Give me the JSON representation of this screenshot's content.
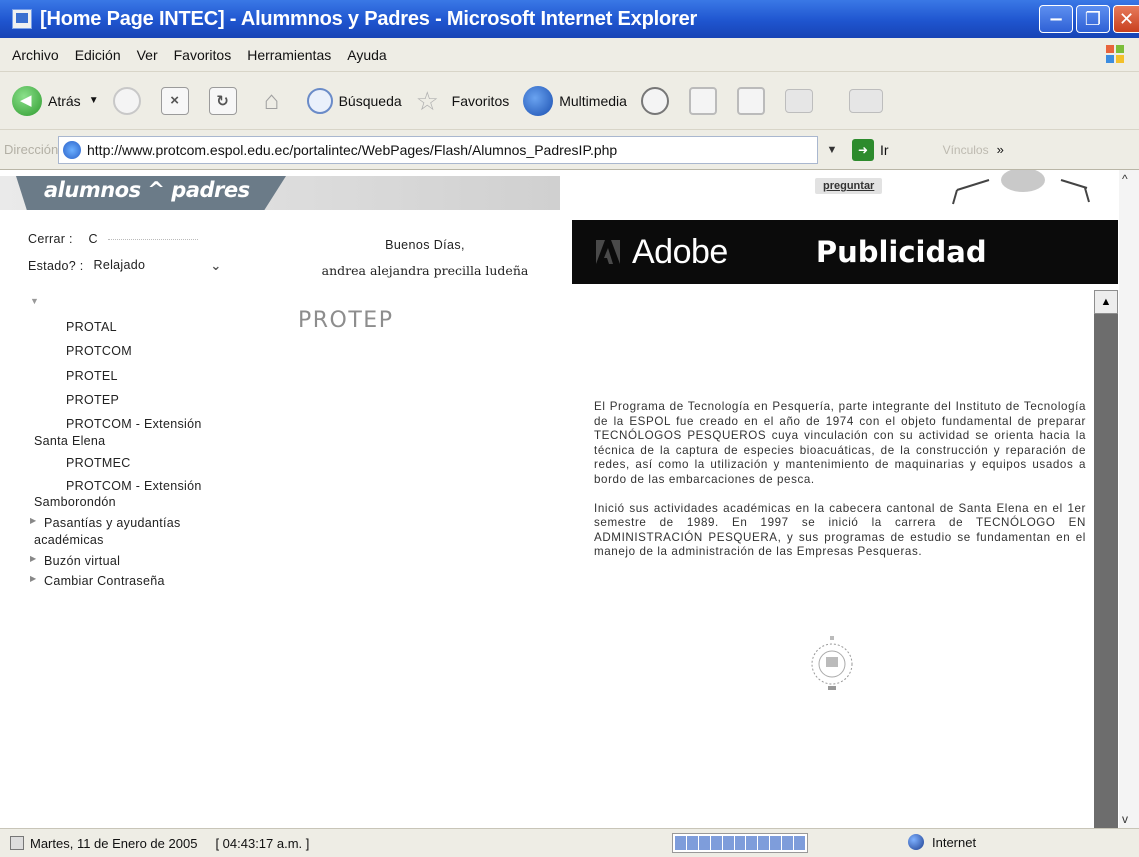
{
  "window": {
    "title": "[Home Page INTEC] - Alummnos y Padres - Microsoft Internet Explorer",
    "buttons": [
      "minimize",
      "maximize",
      "close"
    ]
  },
  "menubar": {
    "items": [
      "Archivo",
      "Edición",
      "Ver",
      "Favoritos",
      "Herramientas",
      "Ayuda"
    ]
  },
  "toolbar": {
    "back_label": "Atrás",
    "search_label": "Búsqueda",
    "favorites_label": "Favoritos",
    "media_label": "Multimedia"
  },
  "address": {
    "label": "Dirección",
    "url": "http://www.protcom.espol.edu.ec/portalintec/WebPages/Flash/Alumnos_PadresIP.php",
    "go_label": "Ir",
    "links_label": "Vínculos"
  },
  "page": {
    "brand": "alumnos ^ padres",
    "ask_label": "preguntar",
    "close_label": "Cerrar :",
    "close_value": "C",
    "state_label": "Estado? :",
    "state_value": "Relajado",
    "greeting": "Buenos Días,",
    "user_name": "andrea alejandra precilla ludeña",
    "nav": {
      "programs": [
        "PROTAL",
        "PROTCOM",
        "PROTEL",
        "PROTEP"
      ],
      "ext1_line1": "PROTCOM - Extensión",
      "ext1_line2": "Santa Elena",
      "protmec": "PROTMEC",
      "ext2_line1": "PROTCOM - Extensión",
      "ext2_line2": "Samborondón",
      "pasantias_line1": "Pasantías y ayudantías",
      "pasantias_line2": "académicas",
      "buzon": "Buzón virtual",
      "cambiar": "Cambiar Contraseña"
    },
    "section_title": "PROTEP",
    "ad": {
      "brand": "Adobe",
      "title": "Publicidad"
    },
    "description": [
      "El Programa de Tecnología en Pesquería, parte integrante del Instituto de Tecnología de la ESPOL fue creado en el año de 1974 con el objeto fundamental de preparar TECNÓLOGOS PESQUEROS cuya vinculación con su actividad se orienta hacia la técnica de la captura de especies bioacuáticas, de la construcción y reparación de redes, así como la utilización y mantenimiento de maquinarias y equipos usados a bordo de las embarcaciones de pesca.",
      "Inició sus actividades académicas en la cabecera cantonal de Santa Elena en el 1er semestre de 1989. En 1997 se inició la carrera de TECNÓLOGO EN ADMINISTRACIÓN PESQUERA, y sus programas de estudio se fundamentan en el manejo de la administración de las Empresas Pesqueras."
    ]
  },
  "statusbar": {
    "date": "Martes, 11 de Enero de 2005",
    "time": "[ 04:43:17 a.m. ]",
    "zone": "Internet"
  },
  "colors": {
    "titlebar": "#1f55cf",
    "chrome": "#eeede5",
    "brand_tab": "#6b7b88",
    "ad_bg": "#0b0b0b"
  }
}
